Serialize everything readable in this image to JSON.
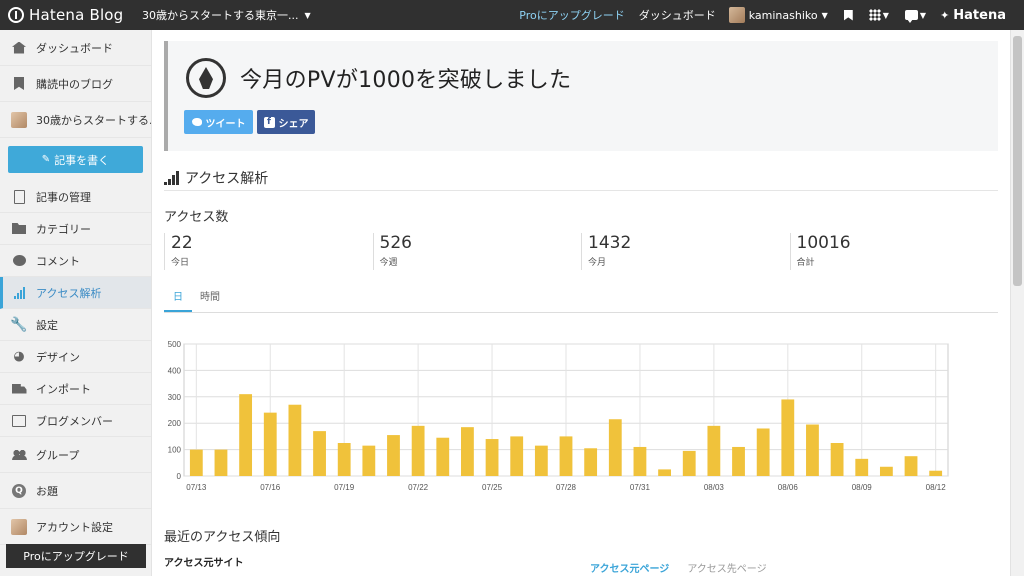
{
  "topbar": {
    "brand": "Hatena Blog",
    "blog_name": "30歳からスタートする東京一...",
    "pro_link": "Proにアップグレード",
    "dashboard_link": "ダッシュボード",
    "username": "kaminashiko",
    "hatena": "Hatena"
  },
  "sidebar": {
    "items": [
      {
        "label": "ダッシュボード",
        "icon": "home-icon"
      },
      {
        "label": "購読中のブログ",
        "icon": "bookmark-icon"
      },
      {
        "label": "30歳からスタートする...",
        "icon": "blog-avatar"
      },
      {
        "label": "記事の管理",
        "icon": "document-icon"
      },
      {
        "label": "カテゴリー",
        "icon": "folder-icon"
      },
      {
        "label": "コメント",
        "icon": "comment-icon"
      },
      {
        "label": "アクセス解析",
        "icon": "access-bars-icon"
      },
      {
        "label": "設定",
        "icon": "wrench-icon"
      },
      {
        "label": "デザイン",
        "icon": "palette-icon"
      },
      {
        "label": "インポート",
        "icon": "truck-icon"
      },
      {
        "label": "ブログメンバー",
        "icon": "member-card-icon"
      },
      {
        "label": "グループ",
        "icon": "group-icon"
      },
      {
        "label": "お題",
        "icon": "question-icon"
      },
      {
        "label": "アカウント設定",
        "icon": "account-avatar"
      }
    ],
    "write_button": "記事を書く",
    "pro_button": "Proにアップグレード"
  },
  "notice": {
    "title": "今月のPVが1000を突破しました",
    "tweet": "ツイート",
    "share": "シェア"
  },
  "access": {
    "section_title": "アクセス解析",
    "count_title": "アクセス数",
    "stats": [
      {
        "value": "22",
        "label": "今日"
      },
      {
        "value": "526",
        "label": "今週"
      },
      {
        "value": "1432",
        "label": "今月"
      },
      {
        "value": "10016",
        "label": "合計"
      }
    ],
    "tabs": [
      "日",
      "時間"
    ]
  },
  "chart_data": {
    "type": "bar",
    "categories": [
      "07/13",
      "07/14",
      "07/15",
      "07/16",
      "07/17",
      "07/18",
      "07/19",
      "07/20",
      "07/21",
      "07/22",
      "07/23",
      "07/24",
      "07/25",
      "07/26",
      "07/27",
      "07/28",
      "07/29",
      "07/30",
      "07/31",
      "08/01",
      "08/02",
      "08/03",
      "08/04",
      "08/05",
      "08/06",
      "08/07",
      "08/08",
      "08/09",
      "08/10",
      "08/11",
      "08/12"
    ],
    "tick_labels": [
      "07/13",
      "07/16",
      "07/19",
      "07/22",
      "07/25",
      "07/28",
      "07/31",
      "08/03",
      "08/06",
      "08/09",
      "08/12"
    ],
    "values": [
      100,
      100,
      310,
      240,
      270,
      170,
      125,
      115,
      155,
      190,
      145,
      185,
      140,
      150,
      115,
      150,
      105,
      215,
      110,
      25,
      95,
      190,
      110,
      180,
      290,
      195,
      125,
      65,
      35,
      75,
      20
    ],
    "yticks": [
      0,
      100,
      200,
      300,
      400,
      500
    ],
    "ylim": [
      0,
      500
    ],
    "grid": true,
    "bar_color": "#f0c23b"
  },
  "recent": {
    "title": "最近のアクセス傾向",
    "referrer_title": "アクセス元サイト",
    "tabs": [
      "アクセス元ページ",
      "アクセス先ページ"
    ]
  }
}
